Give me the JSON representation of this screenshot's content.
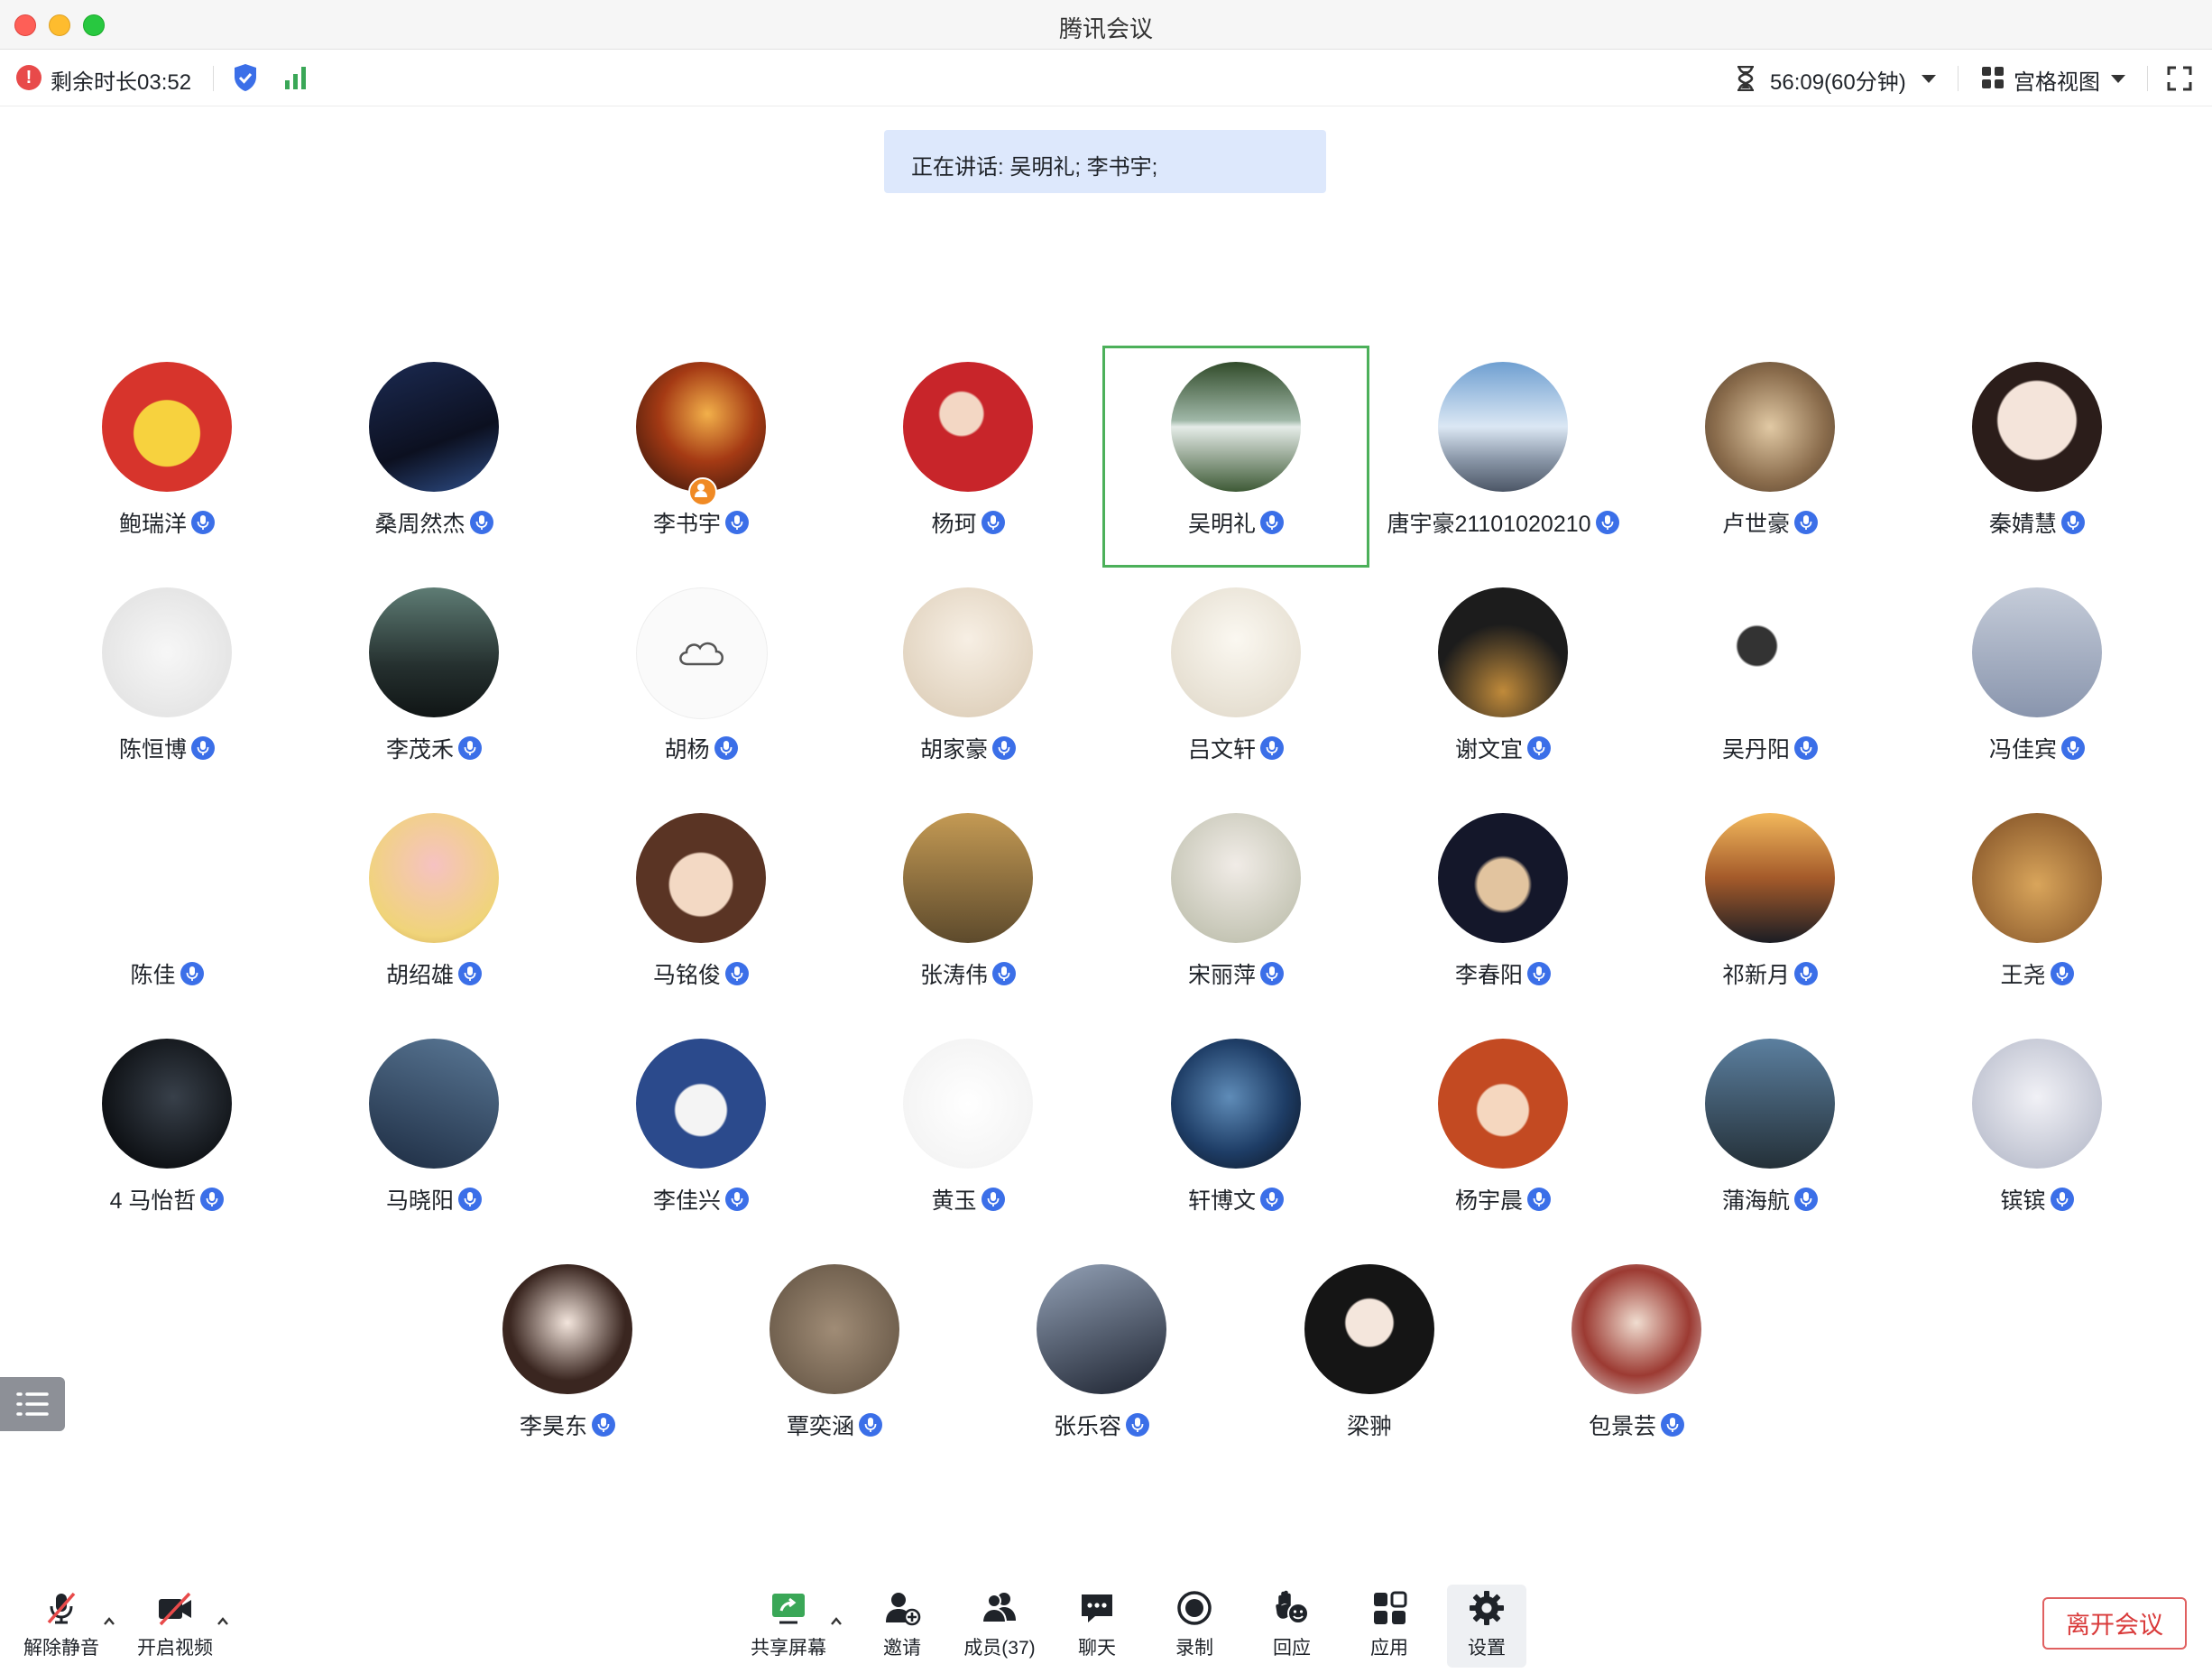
{
  "window": {
    "title": "腾讯会议"
  },
  "status": {
    "remaining_label": "剩余时长03:52",
    "timer_label": "56:09(60分钟)",
    "view_label": "宫格视图"
  },
  "speaking_banner": "正在讲话: 吴明礼; 李书宇;",
  "colors": {
    "accent": "#3b6fe8",
    "active_border": "#4cb05a",
    "leave": "#d93a3a",
    "banner": "#dde8fc"
  },
  "participants": [
    {
      "name": "鲍瑞洋",
      "mic": true
    },
    {
      "name": "桑周然杰",
      "mic": true
    },
    {
      "name": "李书宇",
      "mic": true,
      "host": true
    },
    {
      "name": "杨珂",
      "mic": true
    },
    {
      "name": "吴明礼",
      "mic": true,
      "speaking": true
    },
    {
      "name": "唐宇豪21101020210",
      "mic": true
    },
    {
      "name": "卢世豪",
      "mic": true
    },
    {
      "name": "秦婧慧",
      "mic": true
    },
    {
      "name": "陈恒博",
      "mic": true
    },
    {
      "name": "李茂禾",
      "mic": true
    },
    {
      "name": "胡杨",
      "mic": true
    },
    {
      "name": "胡家豪",
      "mic": true
    },
    {
      "name": "吕文轩",
      "mic": true
    },
    {
      "name": "谢文宜",
      "mic": true
    },
    {
      "name": "吴丹阳",
      "mic": true
    },
    {
      "name": "冯佳宾",
      "mic": true
    },
    {
      "name": "陈佳",
      "mic": true
    },
    {
      "name": "胡绍雄",
      "mic": true
    },
    {
      "name": "马铭俊",
      "mic": true
    },
    {
      "name": "张涛伟",
      "mic": true
    },
    {
      "name": "宋丽萍",
      "mic": true
    },
    {
      "name": "李春阳",
      "mic": true
    },
    {
      "name": "祁新月",
      "mic": true
    },
    {
      "name": "王尧",
      "mic": true
    },
    {
      "name": "4 马怡哲",
      "mic": true
    },
    {
      "name": "马晓阳",
      "mic": true
    },
    {
      "name": "李佳兴",
      "mic": true
    },
    {
      "name": "黄玉",
      "mic": true
    },
    {
      "name": "轩博文",
      "mic": true
    },
    {
      "name": "杨宇晨",
      "mic": true
    },
    {
      "name": "蒲海航",
      "mic": true
    },
    {
      "name": "镔镔",
      "mic": true
    },
    {
      "name": "李昊东",
      "mic": true
    },
    {
      "name": "覃奕涵",
      "mic": true
    },
    {
      "name": "张乐容",
      "mic": true
    },
    {
      "name": "梁翀",
      "mic": false
    },
    {
      "name": "包景芸",
      "mic": true
    }
  ],
  "toolbar": {
    "unmute": "解除静音",
    "video": "开启视频",
    "share": "共享屏幕",
    "invite": "邀请",
    "members": "成员(37)",
    "chat": "聊天",
    "record": "录制",
    "react": "回应",
    "apps": "应用",
    "settings": "设置",
    "leave": "离开会议"
  }
}
